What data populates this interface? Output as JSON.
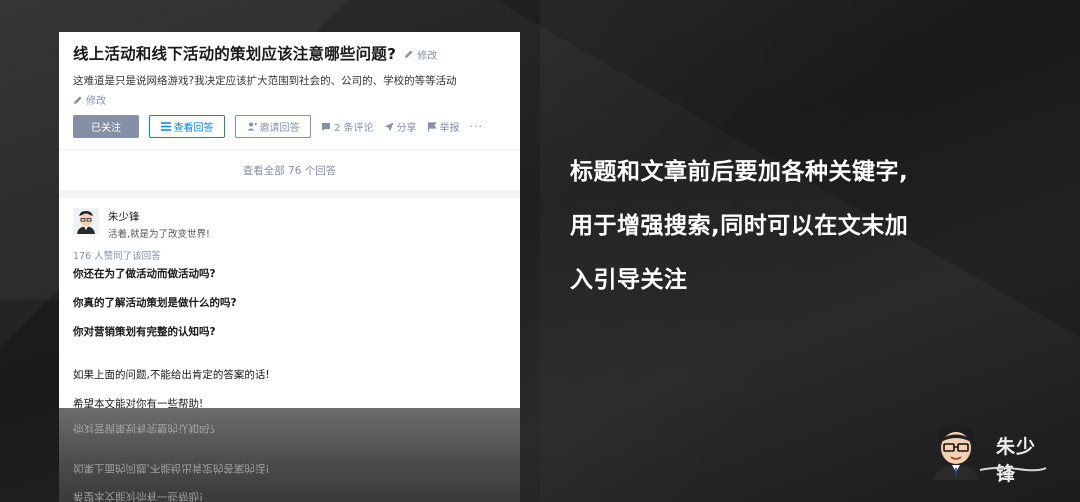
{
  "question": {
    "title": "线上活动和线下活动的策划应该注意哪些问题?",
    "title_edit": "修改",
    "description": "这难道是只是说网络游戏?我决定应该扩大范围到社会的、公司的、学校的等等活动",
    "desc_edit": "修改"
  },
  "actions": {
    "followed": "已关注",
    "view_answers": "查看回答",
    "invite": "邀请回答",
    "comments": "2 条评论",
    "share": "分享",
    "report": "举报",
    "more": "···"
  },
  "view_all": "查看全部 76 个回答",
  "answer": {
    "author_name": "朱少锋",
    "author_bio": "活着,就是为了改变世界!",
    "votes": "176 人赞同了该回答",
    "lines": [
      "你还在为了做活动而做活动吗?",
      "你真的了解活动策划是做什么的吗?",
      "你对营销策划有完整的认知吗?",
      "如果上面的问题,不能给出肯定的答案的话!",
      "希望本文能对你有一些帮助!"
    ]
  },
  "reflection": {
    "lines": [
      "希望本文能对你有一些帮助!",
      "如果上面的问题,不能给出肯定的答案的话!",
      "你对营销策划有完整的认知吗?"
    ]
  },
  "headline": {
    "line1": "标题和文章前后要加各种关键字,",
    "line2": "用于增强搜索,同时可以在文末加",
    "line3": "入引导关注"
  },
  "logo": {
    "name": "朱少锋"
  },
  "icons": {
    "pen": "pen-icon",
    "view": "list-icon",
    "invite": "add-user-icon",
    "comment": "comment-icon",
    "share": "paper-plane-icon",
    "report": "flag-icon"
  },
  "colors": {
    "background": "#262626",
    "link_gray": "#8590a6",
    "accent_blue": "#0084ff",
    "headline": "#ffffff"
  }
}
